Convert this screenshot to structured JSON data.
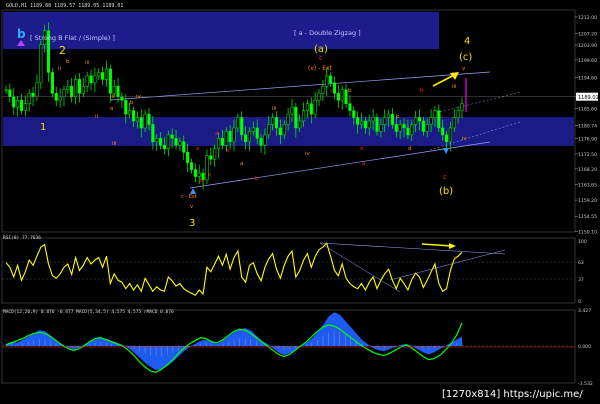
{
  "window": {
    "symbol_line": "GOLD,H1  1189.88 1189.57 1189.05 1189.01",
    "watermark": "[1270x814] https://upic.me/"
  },
  "colors": {
    "background": "#000000",
    "price_bars": "#00ff00",
    "zone": "#1c1c8c",
    "wave_yellow": "#f0e000",
    "wave_orange": "#ff8c00",
    "wave_red": "#ff2020",
    "rsi": "#ffff00",
    "macd_hist": "#2060ff",
    "macd_signal": "#00ff00",
    "arrow_yellow": "#ffee00",
    "arrow_magenta": "#ff00ff",
    "arrow_blue": "#3399ff"
  },
  "annotations": {
    "box_strong_b": "[ Strong B Flat / (Simple) ]",
    "box_double_zigzag": "[ a - Double Zigzag ]",
    "wave_b_top": "b",
    "wave_1": "1",
    "wave_2": "2",
    "wave_3": "3",
    "wave_4": "4",
    "wave_a_paren": "(a)",
    "wave_b_paren": "(b)",
    "wave_c_paren": "(c)",
    "ext_label": "(v) - Ext",
    "wave_c_small": "c",
    "ext_small": "c - Ext"
  },
  "chart_data": [
    {
      "type": "candlestick",
      "title": "GOLD,H1",
      "price_axis_ticks": [
        1212.0,
        1207.2,
        1203.9,
        1199.6,
        1194.6,
        1189.01,
        1185.6,
        1180.74,
        1176.9,
        1172.5,
        1168.2,
        1163.65,
        1159.2,
        1154.55,
        1150.1
      ],
      "current_price": 1189.01,
      "ylim": [
        1150.0,
        1214.0
      ],
      "close_series": [
        1191,
        1189,
        1186,
        1188,
        1185,
        1187,
        1190,
        1189,
        1193,
        1204,
        1208,
        1196,
        1190,
        1188,
        1189,
        1191,
        1192,
        1189,
        1194,
        1190,
        1192,
        1195,
        1193,
        1195,
        1196,
        1194,
        1197,
        1190,
        1192,
        1189,
        1188,
        1184,
        1185,
        1182,
        1183,
        1180,
        1184,
        1181,
        1176,
        1177,
        1175,
        1174,
        1178,
        1177,
        1175,
        1176,
        1173,
        1170,
        1168,
        1166,
        1167,
        1165,
        1172,
        1171,
        1174,
        1177,
        1175,
        1179,
        1176,
        1180,
        1183,
        1178,
        1176,
        1179,
        1180,
        1177,
        1175,
        1178,
        1181,
        1183,
        1180,
        1178,
        1181,
        1184,
        1186,
        1180,
        1182,
        1185,
        1187,
        1184,
        1188,
        1190,
        1192,
        1195,
        1193,
        1190,
        1188,
        1191,
        1187,
        1185,
        1183,
        1181,
        1182,
        1180,
        1182,
        1183,
        1179,
        1181,
        1183,
        1184,
        1181,
        1179,
        1181,
        1180,
        1178,
        1181,
        1183,
        1182,
        1179,
        1181,
        1183,
        1185,
        1180,
        1178,
        1176,
        1180,
        1183,
        1185,
        1187
      ]
    },
    {
      "type": "line",
      "title": "RSI(8) 77.7636",
      "ylim": [
        0,
        100
      ],
      "levels": [
        63,
        37
      ],
      "values": [
        62,
        55,
        40,
        58,
        35,
        48,
        66,
        58,
        72,
        86,
        90,
        60,
        42,
        38,
        45,
        55,
        60,
        44,
        70,
        50,
        58,
        70,
        60,
        66,
        70,
        55,
        72,
        30,
        45,
        35,
        32,
        22,
        30,
        20,
        28,
        18,
        38,
        28,
        18,
        25,
        20,
        18,
        40,
        34,
        26,
        30,
        22,
        18,
        15,
        12,
        20,
        14,
        55,
        48,
        60,
        72,
        58,
        75,
        52,
        70,
        80,
        40,
        32,
        58,
        62,
        45,
        34,
        55,
        68,
        76,
        52,
        38,
        58,
        72,
        80,
        40,
        50,
        66,
        76,
        55,
        72,
        82,
        86,
        92,
        72,
        50,
        42,
        60,
        38,
        30,
        25,
        22,
        30,
        20,
        32,
        40,
        22,
        35,
        45,
        52,
        35,
        22,
        38,
        30,
        20,
        36,
        46,
        40,
        24,
        35,
        48,
        60,
        30,
        18,
        22,
        50,
        68,
        72,
        78
      ]
    },
    {
      "type": "bar",
      "title": "MACD(12,26,9) 0.876 -0.477  MACD(5,34,5) 4.575 4.575  rMACD 0.876",
      "ylim": [
        -3.53,
        3.43
      ],
      "axis_ticks": [
        3.427,
        0.0,
        -3.532
      ],
      "histogram": [
        0.2,
        0.4,
        0.3,
        0.6,
        0.9,
        1.2,
        1.5,
        1.4,
        1.0,
        0.6,
        0.2,
        -0.1,
        -0.3,
        -0.2,
        0.1,
        0.4,
        0.6,
        0.8,
        0.7,
        0.5,
        0.3,
        0.1,
        -0.2,
        -0.6,
        -1.1,
        -1.6,
        -2.0,
        -2.3,
        -2.2,
        -1.9,
        -1.5,
        -1.0,
        -0.5,
        -0.1,
        0.2,
        0.5,
        0.6,
        0.4,
        0.2,
        0.5,
        0.9,
        1.3,
        1.6,
        1.7,
        1.5,
        1.0,
        0.5,
        0.2,
        -0.2,
        -0.6,
        -0.9,
        -0.7,
        -0.4,
        -0.1,
        0.3,
        0.7,
        1.3,
        2.0,
        2.8,
        3.2,
        3.0,
        2.4,
        1.8,
        1.2,
        0.6,
        0.2,
        -0.2,
        -0.4,
        -0.5,
        -0.3,
        -0.1,
        0.1,
        0.2,
        0.0,
        -0.3,
        -0.6,
        -0.8,
        -0.6,
        -0.3,
        0.0,
        0.3,
        0.6,
        0.9
      ],
      "signal": [
        0.1,
        0.3,
        0.5,
        0.7,
        1.0,
        1.2,
        1.3,
        1.2,
        0.9,
        0.5,
        0.1,
        -0.2,
        -0.4,
        -0.3,
        0.0,
        0.4,
        0.7,
        0.8,
        0.6,
        0.4,
        0.2,
        0.0,
        -0.4,
        -0.9,
        -1.5,
        -2.0,
        -2.4,
        -2.5,
        -2.2,
        -1.8,
        -1.3,
        -0.7,
        -0.2,
        0.2,
        0.5,
        0.8,
        0.7,
        0.4,
        0.3,
        0.6,
        1.0,
        1.4,
        1.6,
        1.5,
        1.2,
        0.8,
        0.4,
        0.0,
        -0.4,
        -0.8,
        -1.0,
        -0.8,
        -0.4,
        0.0,
        0.4,
        0.9,
        1.4,
        1.8,
        2.0,
        1.9,
        1.6,
        1.2,
        0.8,
        0.4,
        0.0,
        -0.3,
        -0.6,
        -0.8,
        -0.9,
        -0.7,
        -0.4,
        -0.1,
        0.1,
        -0.2,
        -0.6,
        -1.0,
        -1.3,
        -1.2,
        -0.9,
        -0.4,
        0.2,
        1.0,
        2.2
      ]
    }
  ]
}
